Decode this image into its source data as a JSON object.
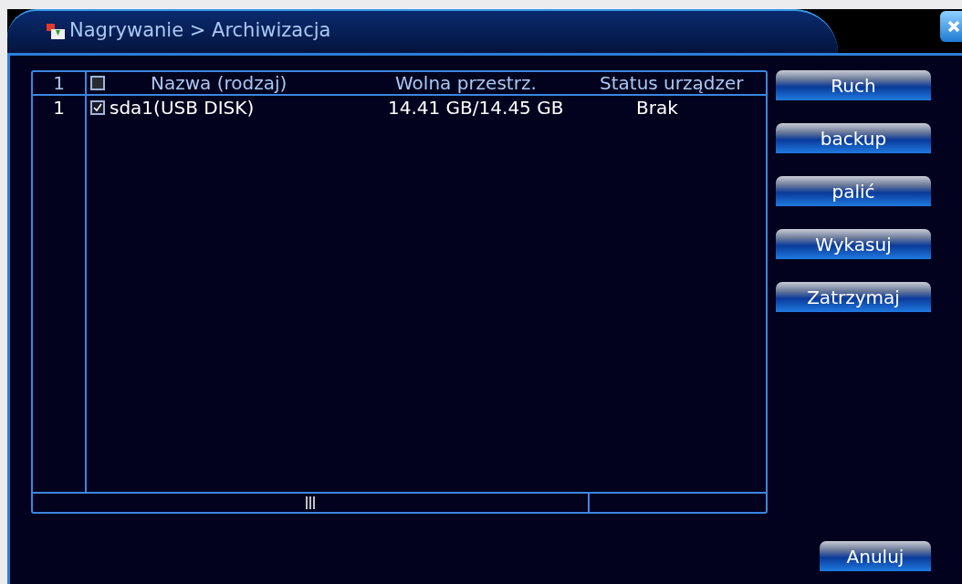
{
  "window": {
    "title": "Nagrywanie > Archiwizacja"
  },
  "table": {
    "header": {
      "number": "1",
      "checked": false,
      "columns": [
        "Nazwa (rodzaj)",
        "Wolna przestrz.",
        "Status urządzer"
      ]
    },
    "rows": [
      {
        "number": "1",
        "checked": true,
        "name": "sda1(USB DISK)",
        "free_space": "14.41 GB/14.45 GB",
        "status": "Brak"
      }
    ]
  },
  "buttons": [
    "Ruch",
    "backup",
    "palić",
    "Wykasuj",
    "Zatrzymaj"
  ],
  "cancel_button": "Anuluj"
}
